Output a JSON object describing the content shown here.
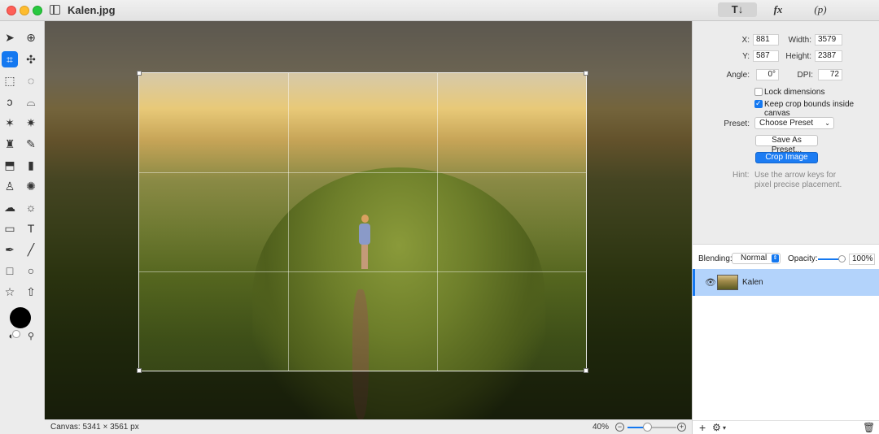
{
  "window": {
    "title": "Kalen.jpg"
  },
  "inspector_tabs": [
    {
      "label": "T↓",
      "icon": "tools-inspector-icon",
      "active": true
    },
    {
      "label": "fx",
      "icon": "effects-icon",
      "active": false
    },
    {
      "label": "(p)",
      "icon": "paths-icon",
      "active": false
    }
  ],
  "toolbox": {
    "tools": [
      {
        "name": "arrow-tool-icon",
        "glyph": "➤"
      },
      {
        "name": "zoom-tool-icon",
        "glyph": "⊕"
      },
      {
        "name": "crop-tool-icon",
        "glyph": "⌗",
        "active": true
      },
      {
        "name": "transform-tool-icon",
        "glyph": "✣"
      },
      {
        "name": "rect-select-icon",
        "glyph": "⬚"
      },
      {
        "name": "ellipse-select-icon",
        "glyph": "◌"
      },
      {
        "name": "lasso-icon",
        "glyph": "ↄ"
      },
      {
        "name": "polygon-lasso-icon",
        "glyph": "⌓"
      },
      {
        "name": "magic-wand-icon",
        "glyph": "✶"
      },
      {
        "name": "magic-eraser-icon",
        "glyph": "✷"
      },
      {
        "name": "paint-bucket-icon",
        "glyph": "♜"
      },
      {
        "name": "pencil-icon",
        "glyph": "✎"
      },
      {
        "name": "eraser-icon",
        "glyph": "⬒"
      },
      {
        "name": "smudge-icon",
        "glyph": "▮"
      },
      {
        "name": "clone-stamp-icon",
        "glyph": "♙"
      },
      {
        "name": "burn-icon",
        "glyph": "✺"
      },
      {
        "name": "cloud-icon",
        "glyph": "☁"
      },
      {
        "name": "brightness-icon",
        "glyph": "☼"
      },
      {
        "name": "gradient-icon",
        "glyph": "▭"
      },
      {
        "name": "text-tool-icon",
        "glyph": "T"
      },
      {
        "name": "pen-tool-icon",
        "glyph": "✒"
      },
      {
        "name": "line-tool-icon",
        "glyph": "╱"
      },
      {
        "name": "rect-shape-icon",
        "glyph": "□"
      },
      {
        "name": "ellipse-shape-icon",
        "glyph": "○"
      },
      {
        "name": "star-shape-icon",
        "glyph": "☆"
      },
      {
        "name": "arrow-shape-icon",
        "glyph": "⇧"
      }
    ],
    "color": "#000000"
  },
  "inspector": {
    "x_label": "X:",
    "x_value": "881",
    "width_label": "Width:",
    "width_value": "3579",
    "y_label": "Y:",
    "y_value": "587",
    "height_label": "Height:",
    "height_value": "2387",
    "angle_label": "Angle:",
    "angle_value": "0°",
    "dpi_label": "DPI:",
    "dpi_value": "72",
    "lock_dimensions": {
      "label": "Lock dimensions",
      "checked": false
    },
    "keep_bounds": {
      "label": "Keep crop bounds inside canvas",
      "checked": true
    },
    "preset_label": "Preset:",
    "preset_value": "Choose Preset",
    "save_preset_label": "Save As Preset...",
    "crop_label": "Crop Image",
    "hint_label": "Hint:",
    "hint_text": "Use the arrow keys for pixel precise placement."
  },
  "layers": {
    "blending_label": "Blending:",
    "blending_value": "Normal",
    "opacity_label": "Opacity:",
    "opacity_value": "100%",
    "opacity_fraction": 1.0,
    "items": [
      {
        "name": "Kalen",
        "visible": true,
        "selected": true
      }
    ]
  },
  "status": {
    "canvas_size": "Canvas: 5341 × 3561 px",
    "zoom_percent": "40%",
    "zoom_fraction": 0.4
  },
  "accent_color": "#1478f0"
}
